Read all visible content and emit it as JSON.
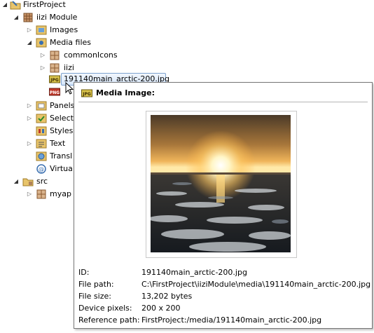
{
  "tree": {
    "items": [
      {
        "label": "FirstProject",
        "icon": "project-folder-icon"
      },
      {
        "label": "iizi Module",
        "icon": "module-icon"
      },
      {
        "label": "Images",
        "icon": "images-folder-icon"
      },
      {
        "label": "Media files",
        "icon": "media-files-folder-icon"
      },
      {
        "label": "commonIcons",
        "icon": "package-icon"
      },
      {
        "label": "iizi",
        "icon": "package-icon"
      },
      {
        "label": "191140main_arctic-200.jpg",
        "icon": "jpg-file-icon"
      },
      {
        "label": "",
        "icon": "png-file-icon"
      },
      {
        "label": "Panels",
        "icon": "panels-folder-icon"
      },
      {
        "label": "Select",
        "icon": "selections-folder-icon"
      },
      {
        "label": "Styles",
        "icon": "styles-folder-icon"
      },
      {
        "label": "Text",
        "icon": "text-folder-icon"
      },
      {
        "label": "Transl",
        "icon": "translations-folder-icon"
      },
      {
        "label": "Virtua",
        "icon": "virtualized-folder-icon"
      },
      {
        "label": "src",
        "icon": "source-folder-icon"
      },
      {
        "label": "myap",
        "icon": "package-icon"
      }
    ]
  },
  "tooltip": {
    "title": "Media Image:",
    "rows": [
      {
        "key": "ID:",
        "value": "191140main_arctic-200.jpg"
      },
      {
        "key": "File path:",
        "value": "C:\\FirstProject\\iiziModule\\media\\191140main_arctic-200.jpg"
      },
      {
        "key": "File size:",
        "value": "13,202  bytes"
      },
      {
        "key": "Device pixels:",
        "value": "200 x 200"
      },
      {
        "key": "Reference path:",
        "value": "FirstProject:/media/191140main_arctic-200.jpg"
      }
    ]
  },
  "icon_badges": {
    "jpg": "JPG",
    "png": "PNG"
  },
  "colors": {
    "selection_border": "#7da2ce",
    "tooltip_border": "#767676",
    "folder": "#e8c46a",
    "package": "#b0825a"
  }
}
